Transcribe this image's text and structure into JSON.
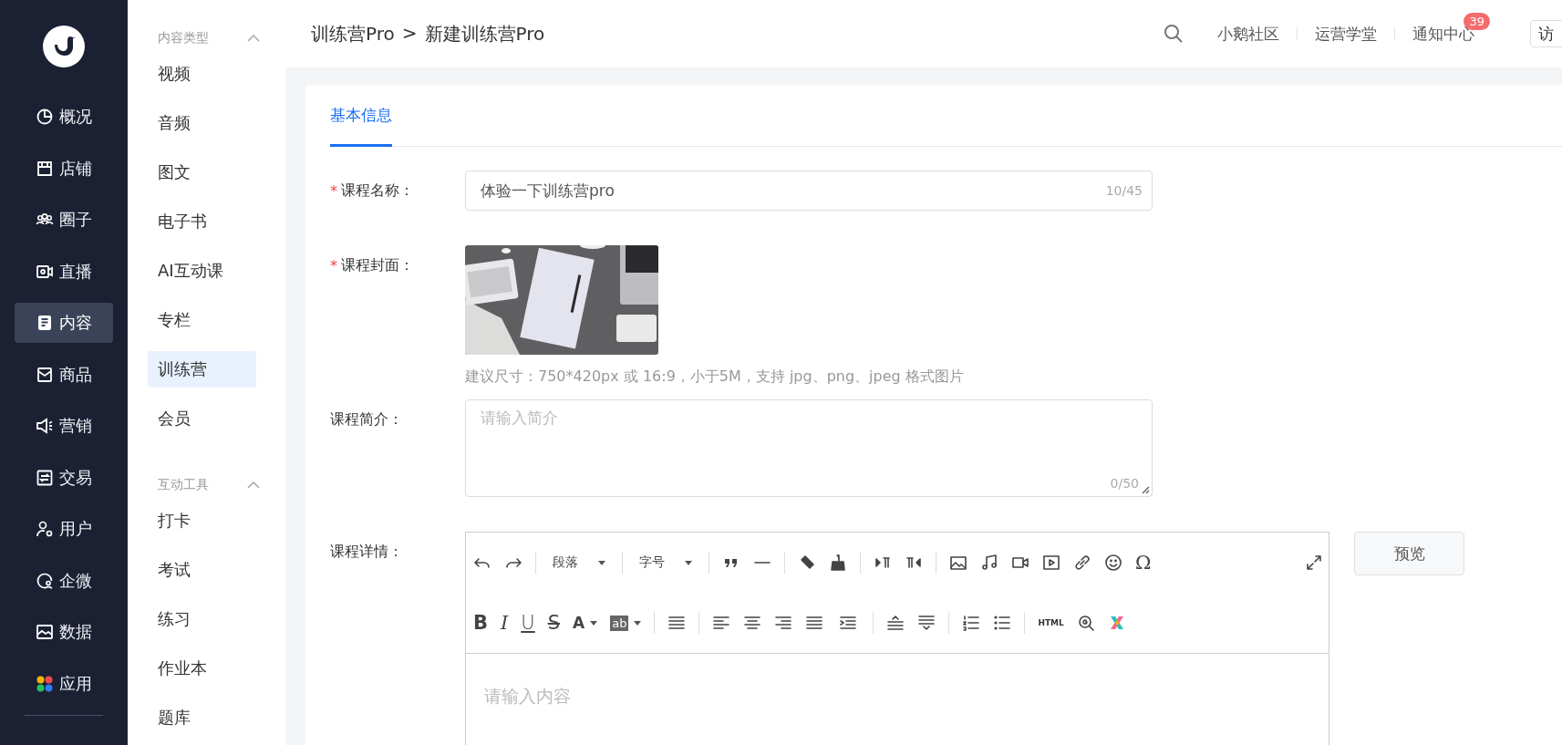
{
  "nav": {
    "items": [
      {
        "label": "概况",
        "selected": false
      },
      {
        "label": "店铺",
        "selected": false
      },
      {
        "label": "圈子",
        "selected": false
      },
      {
        "label": "直播",
        "selected": false
      },
      {
        "label": "内容",
        "selected": true
      },
      {
        "label": "商品",
        "selected": false
      },
      {
        "label": "营销",
        "selected": false
      },
      {
        "label": "交易",
        "selected": false
      },
      {
        "label": "用户",
        "selected": false
      },
      {
        "label": "企微",
        "selected": false
      },
      {
        "label": "数据",
        "selected": false
      },
      {
        "label": "应用",
        "selected": false
      }
    ]
  },
  "subnav": {
    "sections": [
      {
        "title": "内容类型",
        "expanded": true,
        "items": [
          {
            "label": "视频",
            "selected": false
          },
          {
            "label": "音频",
            "selected": false
          },
          {
            "label": "图文",
            "selected": false
          },
          {
            "label": "电子书",
            "selected": false
          },
          {
            "label": "AI互动课",
            "selected": false
          },
          {
            "label": "专栏",
            "selected": false
          },
          {
            "label": "训练营",
            "selected": true
          },
          {
            "label": "会员",
            "selected": false
          }
        ]
      },
      {
        "title": "互动工具",
        "expanded": true,
        "items": [
          {
            "label": "打卡",
            "selected": false
          },
          {
            "label": "考试",
            "selected": false
          },
          {
            "label": "练习",
            "selected": false
          },
          {
            "label": "作业本",
            "selected": false
          },
          {
            "label": "题库",
            "selected": false
          }
        ]
      }
    ]
  },
  "header": {
    "breadcrumb": [
      "训练营Pro",
      "新建训练营Pro"
    ],
    "separator": ">",
    "links": [
      {
        "label": "小鹅社区"
      },
      {
        "label": "运营学堂"
      },
      {
        "label": "通知中心",
        "badge": "39"
      }
    ],
    "visit_button": "访"
  },
  "tabs": [
    {
      "label": "基本信息",
      "selected": true
    }
  ],
  "form": {
    "name": {
      "label": "课程名称：",
      "mark": "*",
      "value": "体验一下训练营pro",
      "counter": "10/45"
    },
    "cover": {
      "label": "课程封面：",
      "mark": "*",
      "hint": "建议尺寸：750*420px 或 16:9，小于5M，支持 jpg、png、jpeg 格式图片"
    },
    "intro": {
      "label": "课程简介：",
      "placeholder": "请输入简介",
      "counter": "0/50"
    },
    "details": {
      "label": "课程详情："
    }
  },
  "editor": {
    "paragraph_select": "段落",
    "size_select": "字号",
    "special_char": "Ω",
    "bold": "B",
    "italic": "I",
    "underline": "U",
    "strike": "S",
    "font_color": "A",
    "highlight": "ab",
    "html": "HTML",
    "placeholder": "请输入内容"
  },
  "preview_button": "预览"
}
